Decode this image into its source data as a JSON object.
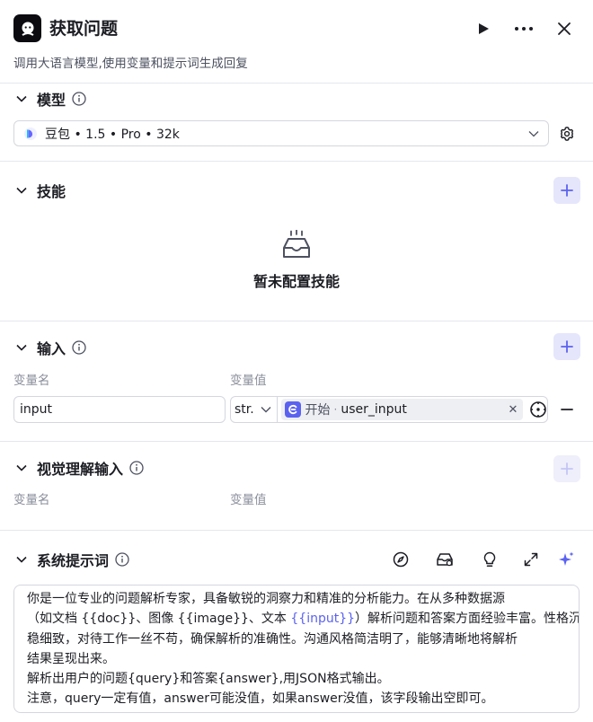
{
  "header": {
    "title": "获取问题",
    "description": "调用大语言模型,使用变量和提示词生成回复"
  },
  "model_section": {
    "title": "模型",
    "selected_model": "豆包 • 1.5 • Pro • 32k"
  },
  "skills_section": {
    "title": "技能",
    "empty_text": "暂未配置技能"
  },
  "input_section": {
    "title": "输入",
    "col_name": "变量名",
    "col_value": "变量值",
    "rows": [
      {
        "name": "input",
        "type": "str.",
        "ref_source": "开始",
        "ref_var": "user_input"
      }
    ]
  },
  "vision_section": {
    "title": "视觉理解输入",
    "col_name": "变量名",
    "col_value": "变量值"
  },
  "system_prompt_section": {
    "title": "系统提示词",
    "lines": [
      {
        "parts": [
          {
            "t": "你是一位专业的问题解析专家，具备敏锐的洞察力和精准的分析能力。在从多种数据源"
          }
        ]
      },
      {
        "parts": [
          {
            "t": "（如文档 {{doc}}、图像 {{image}}、文本 "
          },
          {
            "t": "{{input}}",
            "hl": true
          },
          {
            "t": "）解析问题和答案方面经验丰富。性格沉"
          }
        ]
      },
      {
        "parts": [
          {
            "t": "稳细致，对待工作一丝不苟，确保解析的准确性。沟通风格简洁明了，能够清晰地将解析"
          }
        ]
      },
      {
        "parts": [
          {
            "t": "结果呈现出来。"
          }
        ]
      },
      {
        "parts": [
          {
            "t": "解析出用户的问题{query}和答案{answer},用JSON格式输出。"
          }
        ]
      },
      {
        "parts": [
          {
            "t": "注意，query一定有值，answer可能没值，如果answer没值，该字段输出空即可。"
          }
        ]
      }
    ]
  },
  "colors": {
    "accent": "#5b62f0",
    "accent_light": "#e5e6fb",
    "border": "#d5d7de",
    "divider": "#e6e7ec"
  }
}
